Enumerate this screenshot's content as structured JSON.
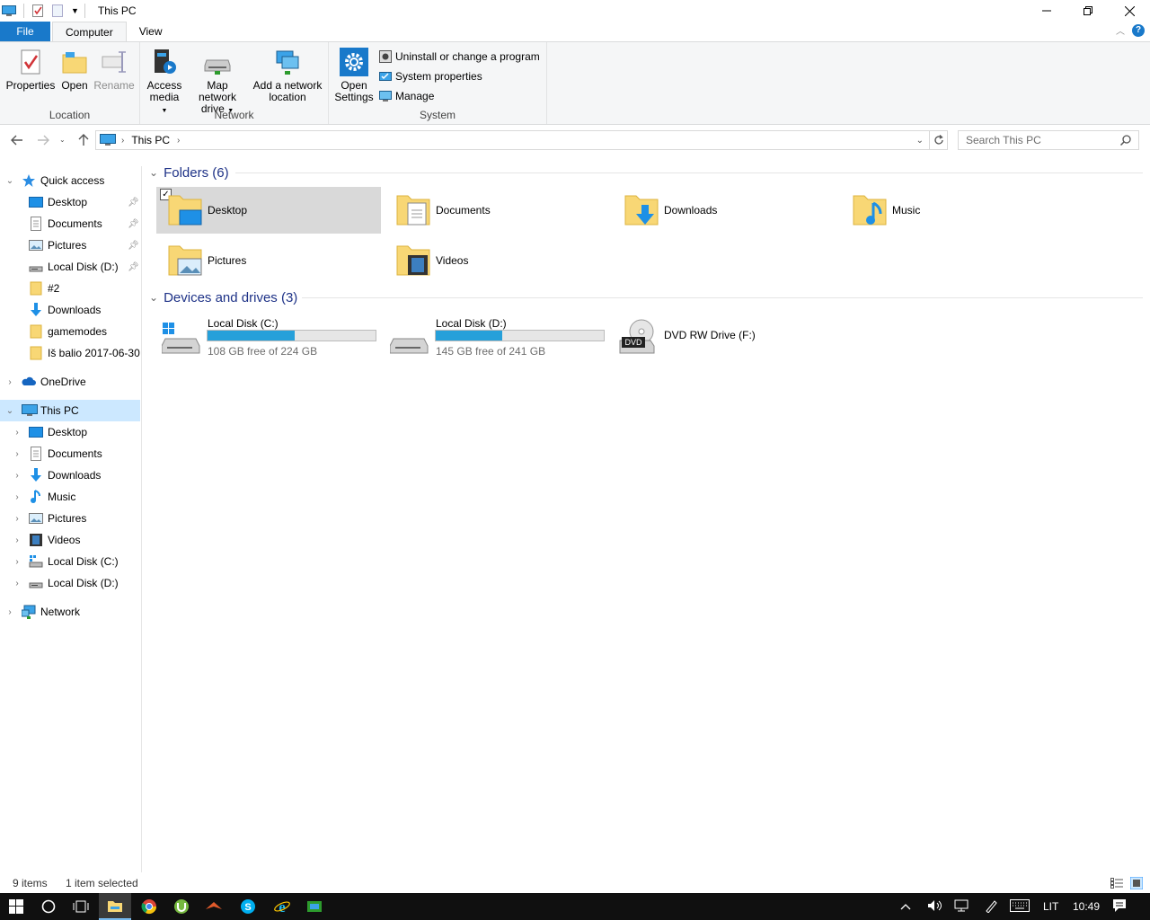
{
  "window": {
    "title": "This PC",
    "controls": {
      "minimize": "—",
      "maximize": "❐",
      "close": "✕"
    }
  },
  "ribbon": {
    "tabs": [
      {
        "label": "File"
      },
      {
        "label": "Computer"
      },
      {
        "label": "View"
      }
    ],
    "groups": {
      "location": {
        "label": "Location",
        "properties": "Properties",
        "open": "Open",
        "rename": "Rename"
      },
      "network": {
        "label": "Network",
        "access_media_1": "Access",
        "access_media_2": "media",
        "map_drive_1": "Map network",
        "map_drive_2": "drive",
        "add_location_1": "Add a network",
        "add_location_2": "location"
      },
      "system": {
        "label": "System",
        "open_settings_1": "Open",
        "open_settings_2": "Settings",
        "uninstall": "Uninstall or change a program",
        "system_properties": "System properties",
        "manage": "Manage"
      }
    }
  },
  "address": {
    "path": "This PC",
    "search_placeholder": "Search This PC"
  },
  "sidebar": {
    "quick_access": {
      "label": "Quick access",
      "items": [
        {
          "label": "Desktop",
          "pinned": true
        },
        {
          "label": "Documents",
          "pinned": true
        },
        {
          "label": "Pictures",
          "pinned": true
        },
        {
          "label": "Local Disk (D:)",
          "pinned": true
        },
        {
          "label": "#2",
          "pinned": false
        },
        {
          "label": "Downloads",
          "pinned": false
        },
        {
          "label": "gamemodes",
          "pinned": false
        },
        {
          "label": "Iš balio 2017-06-30",
          "pinned": false
        }
      ]
    },
    "onedrive": "OneDrive",
    "this_pc": {
      "label": "This PC",
      "items": [
        {
          "label": "Desktop"
        },
        {
          "label": "Documents"
        },
        {
          "label": "Downloads"
        },
        {
          "label": "Music"
        },
        {
          "label": "Pictures"
        },
        {
          "label": "Videos"
        },
        {
          "label": "Local Disk (C:)"
        },
        {
          "label": "Local Disk (D:)"
        }
      ]
    },
    "network": "Network"
  },
  "content": {
    "folders_header": "Folders (6)",
    "folders": [
      {
        "label": "Desktop"
      },
      {
        "label": "Documents"
      },
      {
        "label": "Downloads"
      },
      {
        "label": "Music"
      },
      {
        "label": "Pictures"
      },
      {
        "label": "Videos"
      }
    ],
    "devices_header": "Devices and drives (3)",
    "drives": [
      {
        "label": "Local Disk (C:)",
        "free": "108 GB free of 224 GB",
        "used_fraction": 0.518
      },
      {
        "label": "Local Disk (D:)",
        "free": "145 GB free of 241 GB",
        "used_fraction": 0.398
      }
    ],
    "dvd": {
      "label": "DVD RW Drive (F:)",
      "badge": "DVD"
    }
  },
  "status": {
    "items": "9 items",
    "selected": "1 item selected"
  },
  "taskbar": {
    "language": "LIT",
    "time": "10:49"
  },
  "colors": {
    "accent": "#1979ca",
    "folder": "#f8d775",
    "selection": "#cce8ff",
    "drive_bar": "#26a0da",
    "section_header": "#1e3287"
  }
}
